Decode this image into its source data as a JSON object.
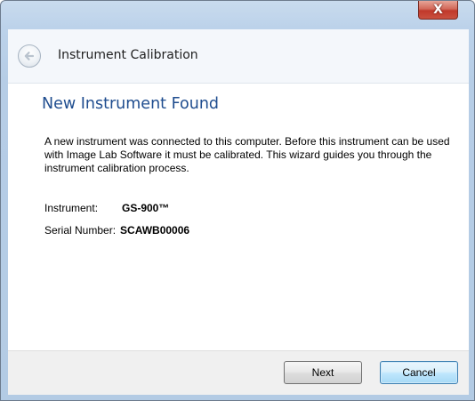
{
  "window": {
    "close_glyph": "X"
  },
  "wizard": {
    "title": "Instrument Calibration",
    "back_icon": "back-arrow-icon"
  },
  "page": {
    "heading": "New Instrument Found",
    "description": "A new instrument was connected to this computer. Before this instrument can be used with Image Lab Software it must be calibrated. This wizard guides you through the instrument calibration process.",
    "fields": {
      "instrument_label": "Instrument:",
      "instrument_value": "GS-900™",
      "serial_label": "Serial Number:",
      "serial_value": "SCAWB00006"
    }
  },
  "buttons": {
    "next_label": "Next",
    "cancel_label": "Cancel"
  },
  "colors": {
    "heading": "#1f4d8f",
    "close_button": "#c0392b",
    "default_button_border": "#3c7fb1"
  }
}
